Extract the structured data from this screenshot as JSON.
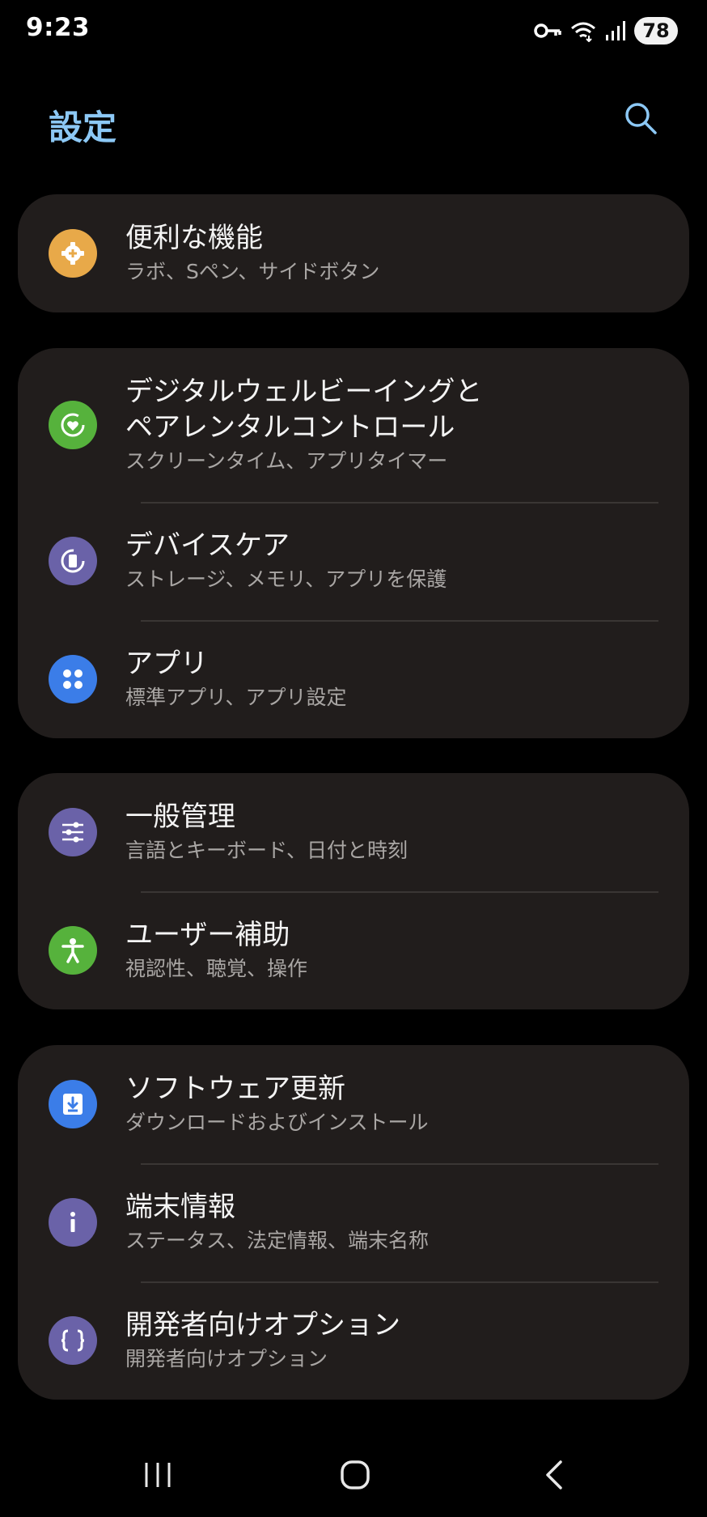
{
  "status_bar": {
    "time": "9:23",
    "battery": "78",
    "icons": [
      "vpn-key-icon",
      "wifi-icon",
      "signal-icon",
      "battery-icon"
    ]
  },
  "header": {
    "title": "設定",
    "search_icon": "search-icon"
  },
  "colors": {
    "background": "#000000",
    "card": "#211d1c",
    "title_accent": "#8cc8f5",
    "subtitle": "#a9a6a4"
  },
  "groups": [
    {
      "items": [
        {
          "title": "便利な機能",
          "subtitle": "ラボ、Sペン、サイドボタン",
          "icon": "gear-plus-icon",
          "icon_color": "#e8a949"
        }
      ]
    },
    {
      "items": [
        {
          "title": "デジタルウェルビーイングと\nペアレンタルコントロール",
          "subtitle": "スクリーンタイム、アプリタイマー",
          "icon": "heart-circle-icon",
          "icon_color": "#56b23c"
        },
        {
          "title": "デバイスケア",
          "subtitle": "ストレージ、メモリ、アプリを保護",
          "icon": "device-care-icon",
          "icon_color": "#6a62a8"
        },
        {
          "title": "アプリ",
          "subtitle": "標準アプリ、アプリ設定",
          "icon": "apps-grid-icon",
          "icon_color": "#3b7de8"
        }
      ]
    },
    {
      "items": [
        {
          "title": "一般管理",
          "subtitle": "言語とキーボード、日付と時刻",
          "icon": "sliders-icon",
          "icon_color": "#6a62a8"
        },
        {
          "title": "ユーザー補助",
          "subtitle": "視認性、聴覚、操作",
          "icon": "accessibility-icon",
          "icon_color": "#56b23c"
        }
      ]
    },
    {
      "items": [
        {
          "title": "ソフトウェア更新",
          "subtitle": "ダウンロードおよびインストール",
          "icon": "download-icon",
          "icon_color": "#3b7de8"
        },
        {
          "title": "端末情報",
          "subtitle": "ステータス、法定情報、端末名称",
          "icon": "info-icon",
          "icon_color": "#6a62a8"
        },
        {
          "title": "開発者向けオプション",
          "subtitle": "開発者向けオプション",
          "icon": "braces-icon",
          "icon_color": "#6a62a8"
        }
      ]
    }
  ],
  "nav_bar": {
    "recents_icon": "recents-icon",
    "home_icon": "home-icon",
    "back_icon": "back-icon"
  }
}
